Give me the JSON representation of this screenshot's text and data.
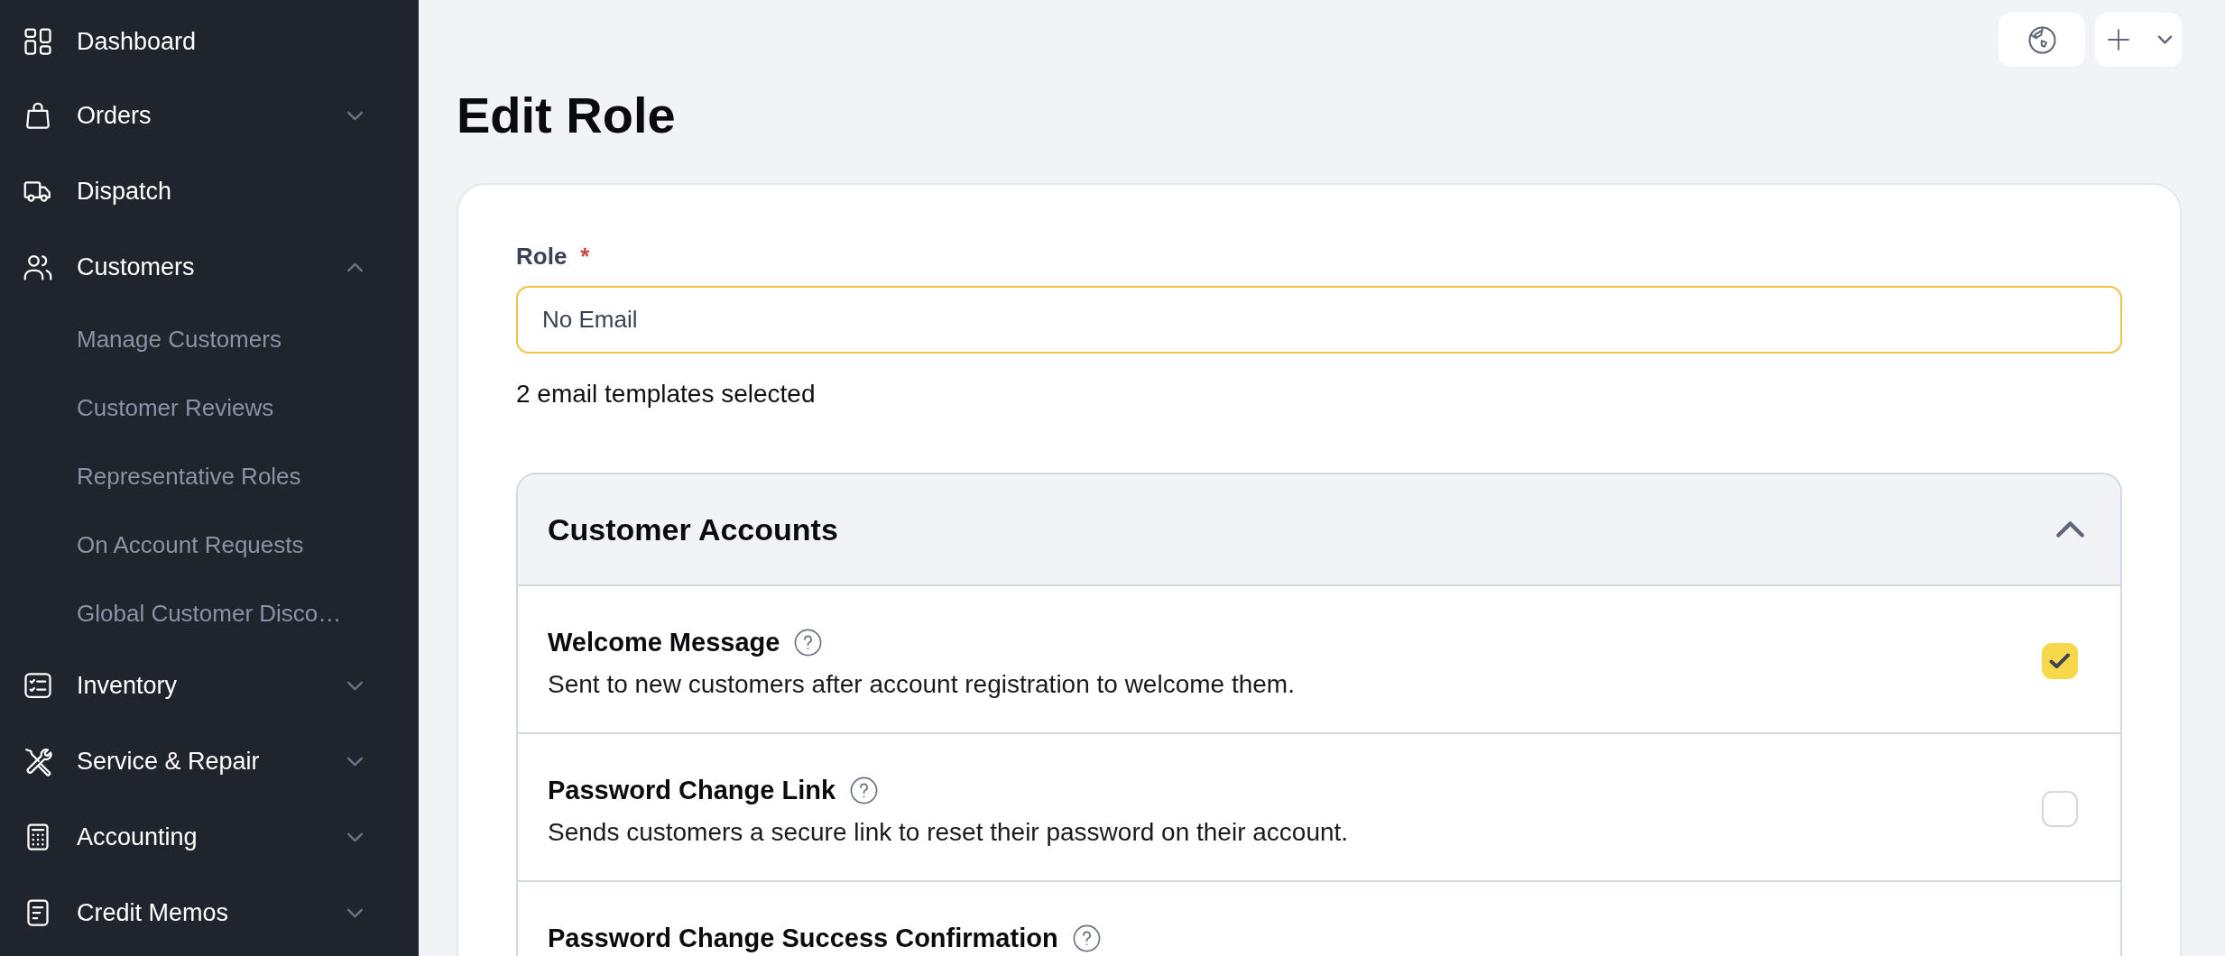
{
  "sidebar": {
    "items": [
      {
        "kind": "link",
        "label": "Dashboard"
      },
      {
        "kind": "group",
        "label": "Orders",
        "expanded": false
      },
      {
        "kind": "link",
        "label": "Dispatch"
      },
      {
        "kind": "group",
        "label": "Customers",
        "expanded": true,
        "children": [
          {
            "label": "Manage Customers"
          },
          {
            "label": "Customer Reviews"
          },
          {
            "label": "Representative Roles"
          },
          {
            "label": "On Account Requests"
          },
          {
            "label": "Global Customer Disco…"
          }
        ]
      },
      {
        "kind": "group",
        "label": "Inventory",
        "expanded": false
      },
      {
        "kind": "group",
        "label": "Service & Repair",
        "expanded": false
      },
      {
        "kind": "group",
        "label": "Accounting",
        "expanded": false
      },
      {
        "kind": "group",
        "label": "Credit Memos",
        "expanded": false
      }
    ]
  },
  "toolbar": {
    "buttons": [
      {
        "kind": "icon"
      },
      {
        "kind": "split"
      }
    ]
  },
  "page": {
    "title": "Edit Role"
  },
  "form": {
    "role": {
      "label": "Role",
      "required_mark": "*",
      "value": "No Email",
      "focused": true
    },
    "helper": "2 email templates selected",
    "sections": [
      {
        "title": "Customer Accounts",
        "expanded": true,
        "templates": [
          {
            "name": "Welcome Message",
            "description": "Sent to new customers after account registration to welcome them.",
            "checked": true
          },
          {
            "name": "Password Change Link",
            "description": "Sends customers a secure link to reset their password on their account.",
            "checked": false
          },
          {
            "name": "Password Change Success Confirmation"
          }
        ]
      }
    ]
  }
}
